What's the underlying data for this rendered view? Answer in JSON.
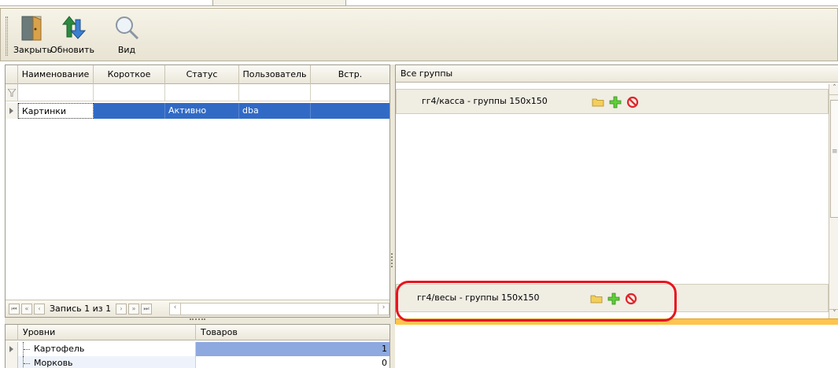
{
  "toolbar": {
    "close_label": "Закрыть",
    "refresh_label": "Обновить",
    "view_label": "Вид"
  },
  "grid": {
    "columns": [
      "Наименование",
      "Короткое",
      "Статус",
      "Пользователь",
      "Встр."
    ],
    "rows": [
      {
        "name": "Картинки",
        "short": "",
        "status": "Активно",
        "user": "dba",
        "builtin": ""
      }
    ],
    "navigator": {
      "record_text": "Запись 1 из 1"
    }
  },
  "levels": {
    "columns": [
      "Уровни",
      "Товаров"
    ],
    "rows": [
      {
        "name": "Картофель",
        "count": "1"
      },
      {
        "name": "Морковь",
        "count": "0"
      }
    ]
  },
  "groups": {
    "header": "Все группы",
    "items": [
      {
        "title": "гг4/касса - группы 150x150"
      },
      {
        "title": "гг4/весы - группы 150x150"
      }
    ]
  },
  "colors": {
    "selection": "#316ac5",
    "highlight_ring": "#e8141e",
    "splitter_active": "#ffc44d"
  }
}
